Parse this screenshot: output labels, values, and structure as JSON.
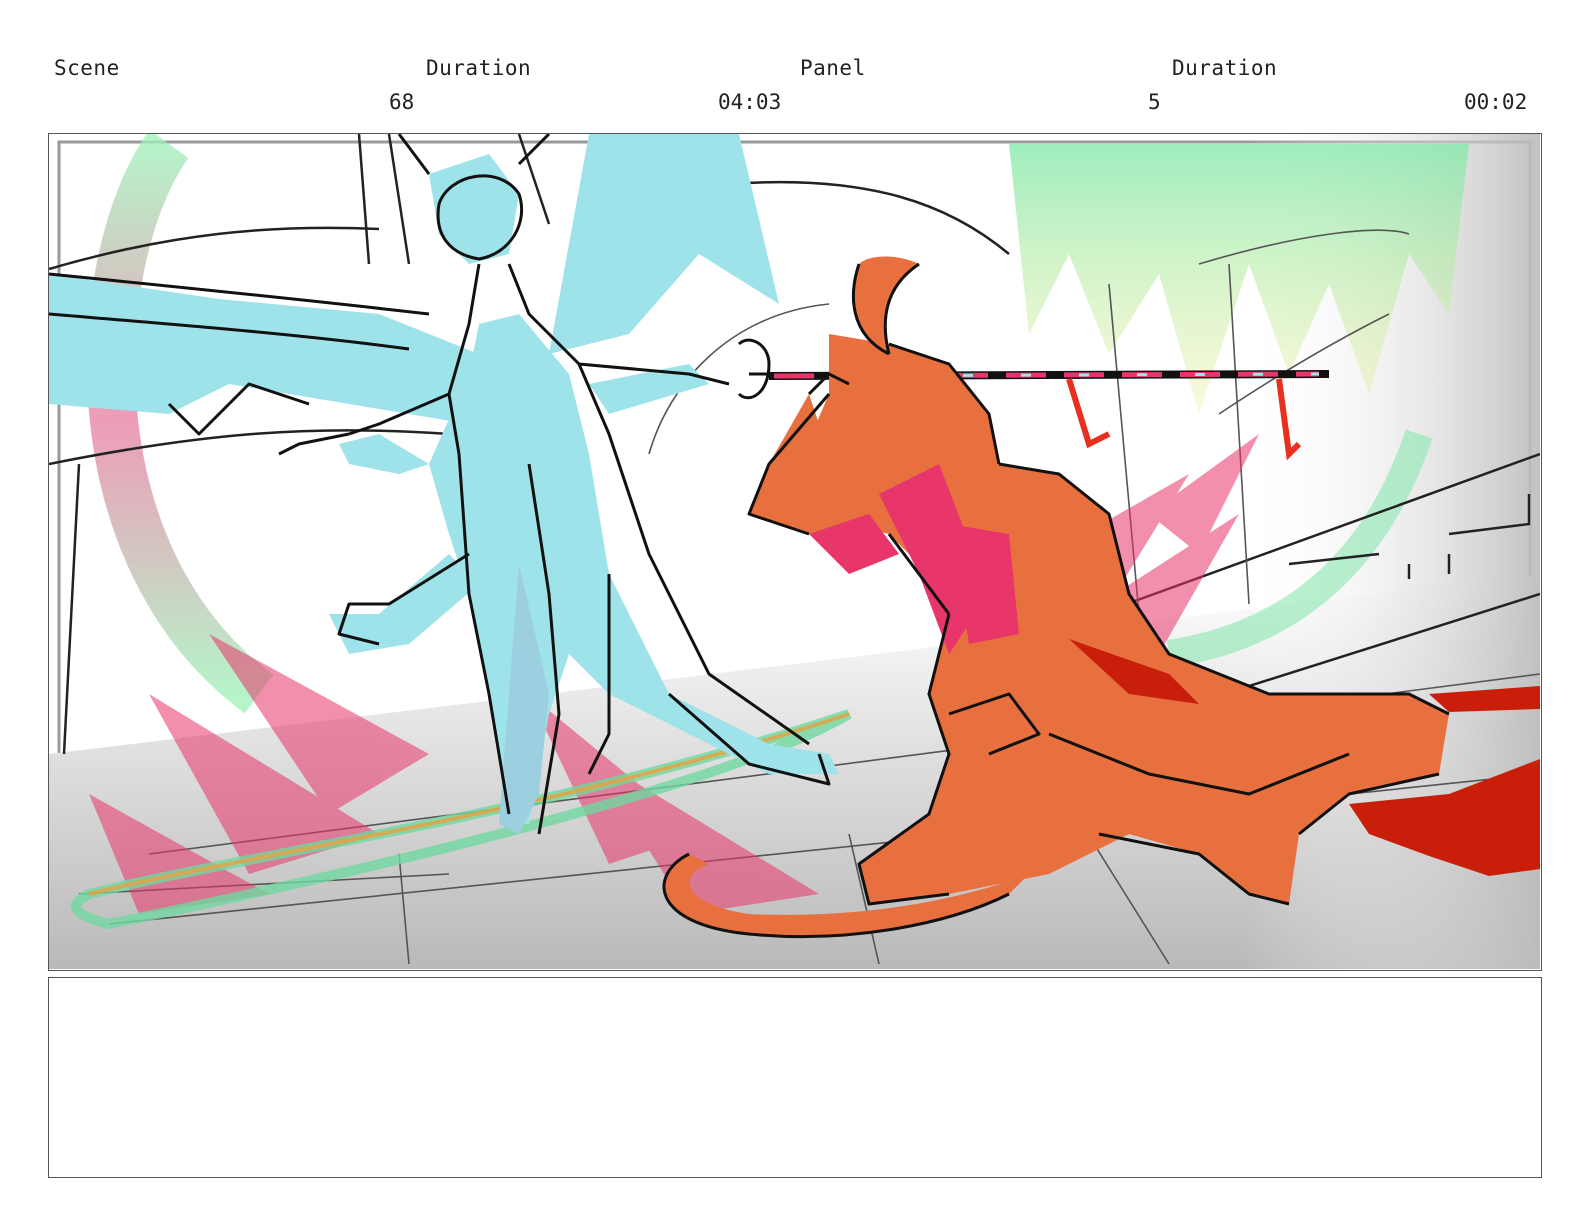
{
  "header": {
    "scene_label": "Scene",
    "scene_duration_label": "Duration",
    "panel_label": "Panel",
    "panel_duration_label": "Duration",
    "scene_number": "68",
    "scene_duration": "04:03",
    "panel_number": "5",
    "panel_duration": "00:02"
  },
  "notes": {
    "text": ""
  },
  "colors": {
    "left_character": "#9fe3ea",
    "right_character": "#e8703f",
    "accent_pink": "#e8356a",
    "accent_green": "#7fe8a8",
    "blood_red": "#c81e0a",
    "frame_border": "#555555"
  }
}
